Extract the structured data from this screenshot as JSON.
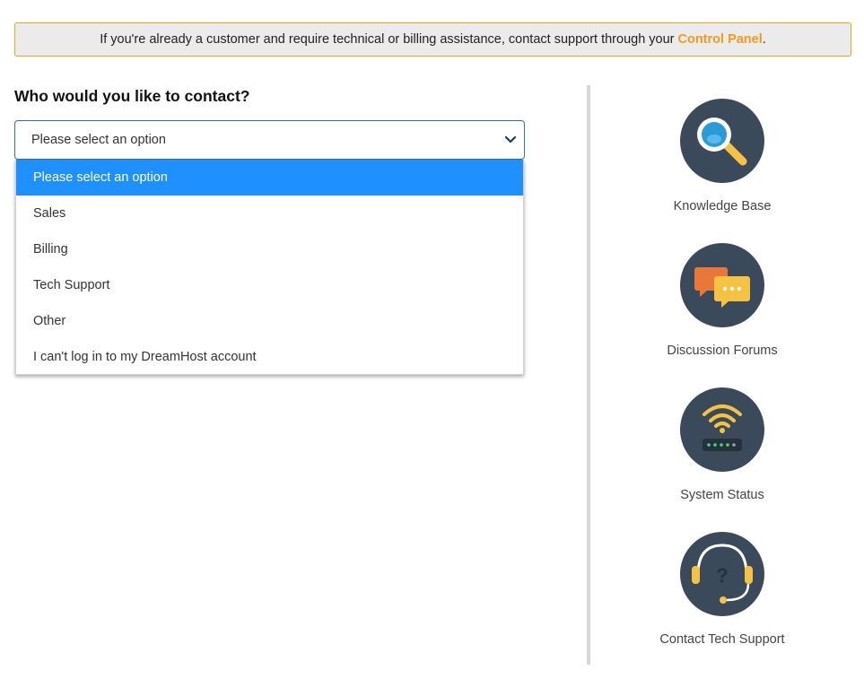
{
  "notice": {
    "text": "If you're already a customer and require technical or billing assistance, contact support through your",
    "link_label": "Control Panel",
    "suffix": "."
  },
  "form": {
    "question": "Who would you like to contact?",
    "selected_value": "Please select an option",
    "options": [
      "Please select an option",
      "Sales",
      "Billing",
      "Tech Support",
      "Other",
      "I can't log in to my DreamHost account"
    ]
  },
  "resources": [
    {
      "label": "Knowledge Base",
      "icon": "magnifier-icon"
    },
    {
      "label": "Discussion Forums",
      "icon": "chat-bubbles-icon"
    },
    {
      "label": "System Status",
      "icon": "wifi-router-icon"
    },
    {
      "label": "Contact Tech Support",
      "icon": "headset-icon"
    }
  ],
  "colors": {
    "accent": "#f29a1f",
    "selected_option": "#1e90ff",
    "icon_circle": "#3a4a5a",
    "icon_yellow": "#f5c242"
  }
}
